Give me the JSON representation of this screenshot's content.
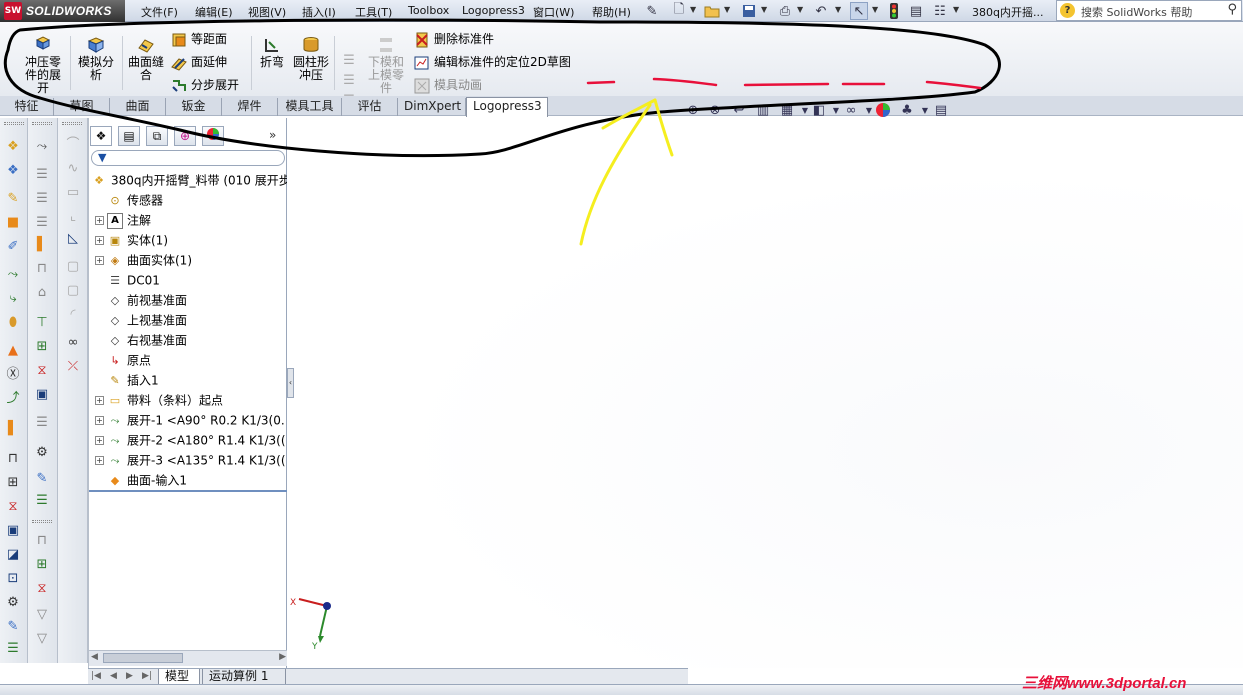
{
  "app": {
    "logo_badge": "SW",
    "logo_text": "SOLIDWORKS",
    "brand_color": "#c8102e"
  },
  "menu": [
    "文件(F)",
    "编辑(E)",
    "视图(V)",
    "插入(I)",
    "工具(T)",
    "Toolbox",
    "Logopress3",
    "窗口(W)",
    "帮助(H)"
  ],
  "title": {
    "document": "380q内开摇..."
  },
  "help_search": {
    "placeholder": "搜索 SolidWorks 帮助"
  },
  "ribbon": {
    "unfold_button": {
      "line1": "冲压零",
      "line2": "件的展",
      "line3": "开Log..."
    },
    "simulate_button": {
      "line1": "模拟分",
      "line2": "析"
    },
    "surface_sew_button": {
      "line1": "曲面缝",
      "line2": "合"
    },
    "equidistance": "等距面",
    "surface_extend": "面延伸",
    "step_unfold": "分步展开",
    "fold_button": "折弯",
    "cylinder_button": {
      "line1": "圆柱形",
      "line2": "冲压"
    },
    "die_button": {
      "line1": "下模和",
      "line2": "上模零",
      "line3": "件"
    },
    "delete_std": "删除标准件",
    "edit_std_pos": "编辑标准件的定位2D草图",
    "die_anim": "模具动画"
  },
  "tabs": [
    "特征",
    "草图",
    "曲面",
    "钣金",
    "焊件",
    "模具工具",
    "评估",
    "DimXpert",
    "Logopress3"
  ],
  "active_tab": "Logopress3",
  "feature_tree": {
    "root": "380q内开摇臂_料带  (010 展开步",
    "items": [
      {
        "label": "传感器",
        "icon": "sensor-icon",
        "expand": false
      },
      {
        "label": "注解",
        "icon": "annotation-icon",
        "expand": true
      },
      {
        "label": "实体(1)",
        "icon": "solid-bodies-icon",
        "expand": true
      },
      {
        "label": "曲面实体(1)",
        "icon": "surface-bodies-icon",
        "expand": true
      },
      {
        "label": "DC01",
        "icon": "material-icon",
        "expand": false
      },
      {
        "label": "前视基准面",
        "icon": "plane-icon",
        "expand": false
      },
      {
        "label": "上视基准面",
        "icon": "plane-icon",
        "expand": false
      },
      {
        "label": "右视基准面",
        "icon": "plane-icon",
        "expand": false
      },
      {
        "label": "原点",
        "icon": "origin-icon",
        "expand": false
      },
      {
        "label": "插入1",
        "icon": "insert-icon",
        "expand": false
      },
      {
        "label": "带料（条料）起点",
        "icon": "folder-icon",
        "expand": true
      },
      {
        "label": "展开-1   <A90° R0.2 K1/3(0.",
        "icon": "unfold-feature-icon",
        "expand": true
      },
      {
        "label": "展开-2   <A180° R1.4 K1/3((",
        "icon": "unfold-feature-icon",
        "expand": true
      },
      {
        "label": "展开-3   <A135° R1.4 K1/3((",
        "icon": "unfold-feature-icon",
        "expand": true
      },
      {
        "label": "曲面-输入1",
        "icon": "surface-import-icon",
        "expand": false
      }
    ]
  },
  "triad": {
    "x": "X",
    "y": "Y"
  },
  "model_tabs": [
    "模型",
    "运动算例 1"
  ],
  "watermark": "三维网www.3dportal.cn",
  "annotation_colors": {
    "outline": "#000000",
    "dash": "#e8103a",
    "arrow": "#f5ee1f"
  }
}
